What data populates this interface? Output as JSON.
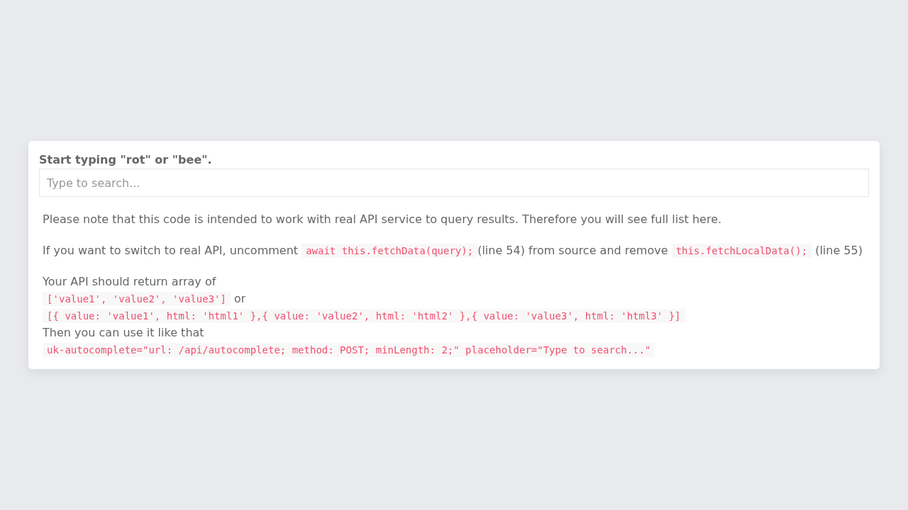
{
  "label": "Start typing \"rot\" or \"bee\".",
  "search": {
    "placeholder": "Type to search..."
  },
  "paragraphs": [
    {
      "lines": [
        [
          {
            "kind": "text",
            "text": "Please note that this code is intended to work with real API service to query results. Therefore you will see full list here."
          }
        ]
      ]
    },
    {
      "lines": [
        [
          {
            "kind": "text",
            "text": "If you want to switch to real API, uncomment "
          },
          {
            "kind": "code",
            "text": "await this.fetchData(query);"
          },
          {
            "kind": "text",
            "text": "(line 54) from source and remove "
          },
          {
            "kind": "code",
            "text": "this.fetchLocalData();"
          },
          {
            "kind": "text",
            "text": " (line 55)"
          }
        ]
      ]
    },
    {
      "lines": [
        [
          {
            "kind": "text",
            "text": "Your API should return array of"
          }
        ],
        [
          {
            "kind": "code",
            "text": "['value1', 'value2', 'value3']"
          },
          {
            "kind": "text",
            "text": " or"
          }
        ],
        [
          {
            "kind": "code",
            "text": "[{ value: 'value1', html: 'html1' },{ value: 'value2', html: 'html2' },{ value: 'value3', html: 'html3' }]"
          }
        ],
        [
          {
            "kind": "text",
            "text": "Then you can use it like that"
          }
        ],
        [
          {
            "kind": "code",
            "text": "uk-autocomplete=\"url: /api/autocomplete; method: POST; minLength: 2;\" placeholder=\"Type to search...\""
          }
        ]
      ]
    }
  ]
}
